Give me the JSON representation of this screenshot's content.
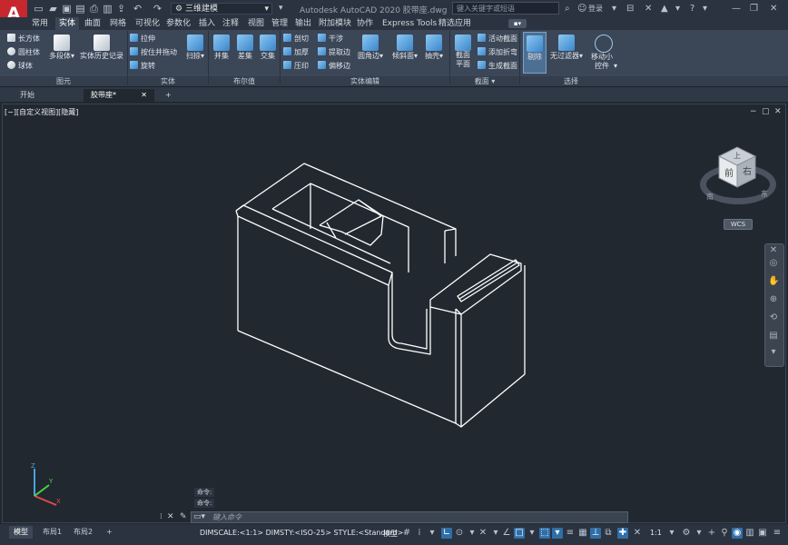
{
  "app": {
    "logo_letter": "A",
    "workspace": "三维建模",
    "title": "Autodesk AutoCAD 2020    胶带座.dwg",
    "search_placeholder": "键入关键字或短语",
    "login": "登录"
  },
  "ribbon_tabs": [
    "常用",
    "实体",
    "曲面",
    "网格",
    "可视化",
    "参数化",
    "插入",
    "注释",
    "视图",
    "管理",
    "输出",
    "附加模块",
    "协作",
    "Express Tools",
    "精选应用"
  ],
  "ribbon": {
    "primitive": {
      "title": "图元",
      "small": [
        "长方体",
        "圆柱体",
        "球体"
      ],
      "big": [
        "多段体"
      ]
    },
    "history": {
      "label": "实体历史记录"
    },
    "solid": {
      "title": "实体",
      "small": [
        "拉伸",
        "按住并拖动",
        "旋转"
      ],
      "big": [
        "扫掠"
      ]
    },
    "boolean": {
      "title": "布尔值",
      "big": [
        "并集",
        "差集",
        "交集"
      ]
    },
    "solid_edit": {
      "title": "实体编辑",
      "small": [
        "剖切",
        "加厚",
        "压印",
        "干涉",
        "提取边",
        "偏移边"
      ],
      "big": [
        "圆角边",
        "倾斜面",
        "抽壳"
      ]
    },
    "section": {
      "title": "截面",
      "big": "截面平面",
      "small": [
        "活动截面",
        "添加折弯",
        "生成截面"
      ]
    },
    "select": {
      "title": "选择",
      "big": [
        "剔除",
        "无过滤器",
        "移动小控件"
      ]
    }
  },
  "doc_tabs": [
    "开始",
    "胶带座*"
  ],
  "viewport": {
    "label": "[−][自定义视图][隐藏]",
    "viewcube": {
      "top": "上",
      "front": "前",
      "right": "右",
      "south": "南",
      "east": "东"
    },
    "wcs": "WCS"
  },
  "command": {
    "history": [
      "命令:",
      "命令:"
    ],
    "placeholder": "键入命令"
  },
  "layout_tabs": [
    "模型",
    "布局1",
    "布局2"
  ],
  "status": {
    "text": "DIMSCALE:<1:1> DIMSTY:<ISO-25> STYLE:<Standard>",
    "mode": "模型",
    "scale": "1:1"
  },
  "colors": {
    "accent": "#2f6fa8",
    "logo": "#c7282e",
    "background": "#212830",
    "ribbon": "#3b4657"
  }
}
